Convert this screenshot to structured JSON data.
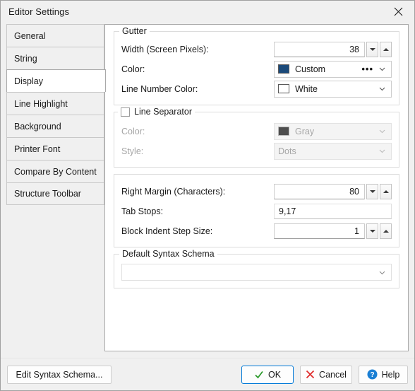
{
  "window": {
    "title": "Editor Settings",
    "close_icon": "close-icon"
  },
  "tabs": [
    {
      "label": "General",
      "selected": false
    },
    {
      "label": "String",
      "selected": false
    },
    {
      "label": "Display",
      "selected": true
    },
    {
      "label": "Line Highlight",
      "selected": false
    },
    {
      "label": "Background",
      "selected": false
    },
    {
      "label": "Printer Font",
      "selected": false
    },
    {
      "label": "Compare By Content",
      "selected": false
    },
    {
      "label": "Structure Toolbar",
      "selected": false
    }
  ],
  "gutter": {
    "title": "Gutter",
    "width_label": "Width (Screen Pixels):",
    "width_value": "38",
    "color_label": "Color:",
    "color_value": "Custom",
    "color_swatch": "#1b4a7a",
    "color_ellipsis": "•••",
    "line_number_color_label": "Line Number Color:",
    "line_number_color_value": "White",
    "line_number_swatch": "#ffffff"
  },
  "line_separator": {
    "title": "Line Separator",
    "checked": false,
    "color_label": "Color:",
    "color_value": "Gray",
    "color_swatch": "#4d4d4d",
    "style_label": "Style:",
    "style_value": "Dots",
    "disabled": true
  },
  "margins": {
    "right_margin_label": "Right Margin (Characters):",
    "right_margin_value": "80",
    "tab_stops_label": "Tab Stops:",
    "tab_stops_value": "9,17",
    "block_indent_label": "Block Indent Step Size:",
    "block_indent_value": "1"
  },
  "syntax_schema": {
    "title": "Default Syntax Schema",
    "value": ""
  },
  "buttons": {
    "edit_schema": "Edit Syntax Schema...",
    "ok": "OK",
    "cancel": "Cancel",
    "help": "Help"
  },
  "colors": {
    "accent": "#0078d7",
    "ok_check": "#2e9b2e",
    "cancel_x": "#e03030",
    "help_blue": "#1a7fd4"
  }
}
